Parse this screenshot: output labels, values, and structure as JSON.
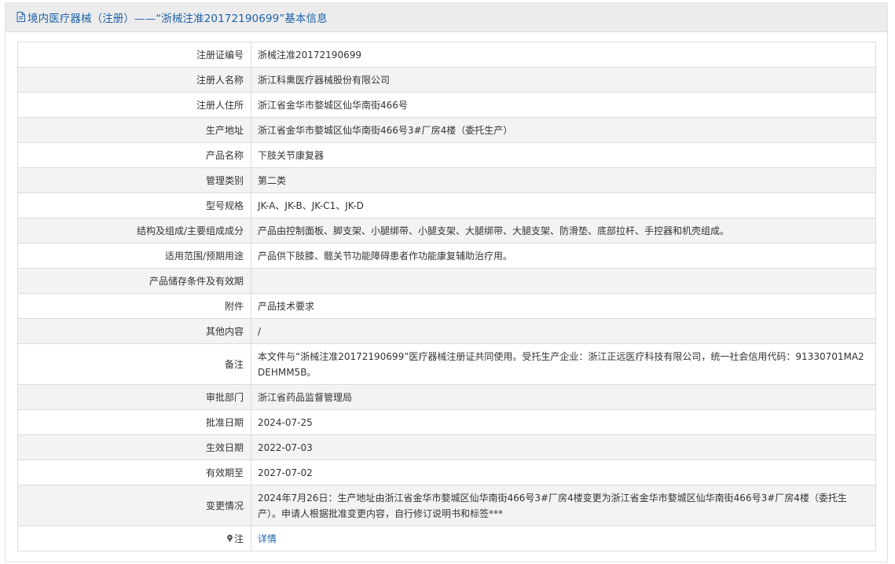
{
  "header": {
    "title": "境内医疗器械（注册）——“浙械注准20172190699”基本信息",
    "icon": "document-icon"
  },
  "rows": [
    {
      "label": "注册证编号",
      "value": "浙械注准20172190699"
    },
    {
      "label": "注册人名称",
      "value": "浙江科熏医疗器械股份有限公司"
    },
    {
      "label": "注册人住所",
      "value": "浙江省金华市婺城区仙华南街466号"
    },
    {
      "label": "生产地址",
      "value": "浙江省金华市婺城区仙华南街466号3#厂房4楼（委托生产）"
    },
    {
      "label": "产品名称",
      "value": "下肢关节康复器"
    },
    {
      "label": "管理类别",
      "value": "第二类"
    },
    {
      "label": "型号规格",
      "value": "JK-A、JK-B、JK-C1、JK-D"
    },
    {
      "label": "结构及组成/主要组成成分",
      "value": "产品由控制面板、脚支架、小腿绑带、小腿支架、大腿绑带、大腿支架、防滑垫、底部拉杆、手控器和机壳组成。"
    },
    {
      "label": "适用范围/预期用途",
      "value": "产品供下肢膝、髋关节功能障碍患者作功能康复辅助治疗用。"
    },
    {
      "label": "产品储存条件及有效期",
      "value": ""
    },
    {
      "label": "附件",
      "value": "产品技术要求"
    },
    {
      "label": "其他内容",
      "value": "/"
    },
    {
      "label": "备注",
      "value": "本文件与“浙械注准20172190699”医疗器械注册证共同使用。受托生产企业：浙江正远医疗科技有限公司，统一社会信用代码：91330701MA2DEHMM5B。"
    },
    {
      "label": "审批部门",
      "value": "浙江省药品监督管理局"
    },
    {
      "label": "批准日期",
      "value": "2024-07-25"
    },
    {
      "label": "生效日期",
      "value": "2022-07-03"
    },
    {
      "label": "有效期至",
      "value": "2027-07-02"
    },
    {
      "label": "变更情况",
      "value": "2024年7月26日：生产地址由浙江省金华市婺城区仙华南街466号3#厂房4楼变更为浙江省金华市婺城区仙华南街466号3#厂房4楼（委托生产）。申请人根据批准变更内容，自行修订说明书和标签***"
    }
  ],
  "note_row": {
    "label": "注",
    "icon": "pin-icon",
    "link_text": "详情"
  },
  "colors": {
    "title_text": "#1e62a8",
    "title_bg": "#ececec",
    "row_alt_bg": "#f3f3f3",
    "border": "#dcdcdc",
    "link": "#1e62a8"
  }
}
